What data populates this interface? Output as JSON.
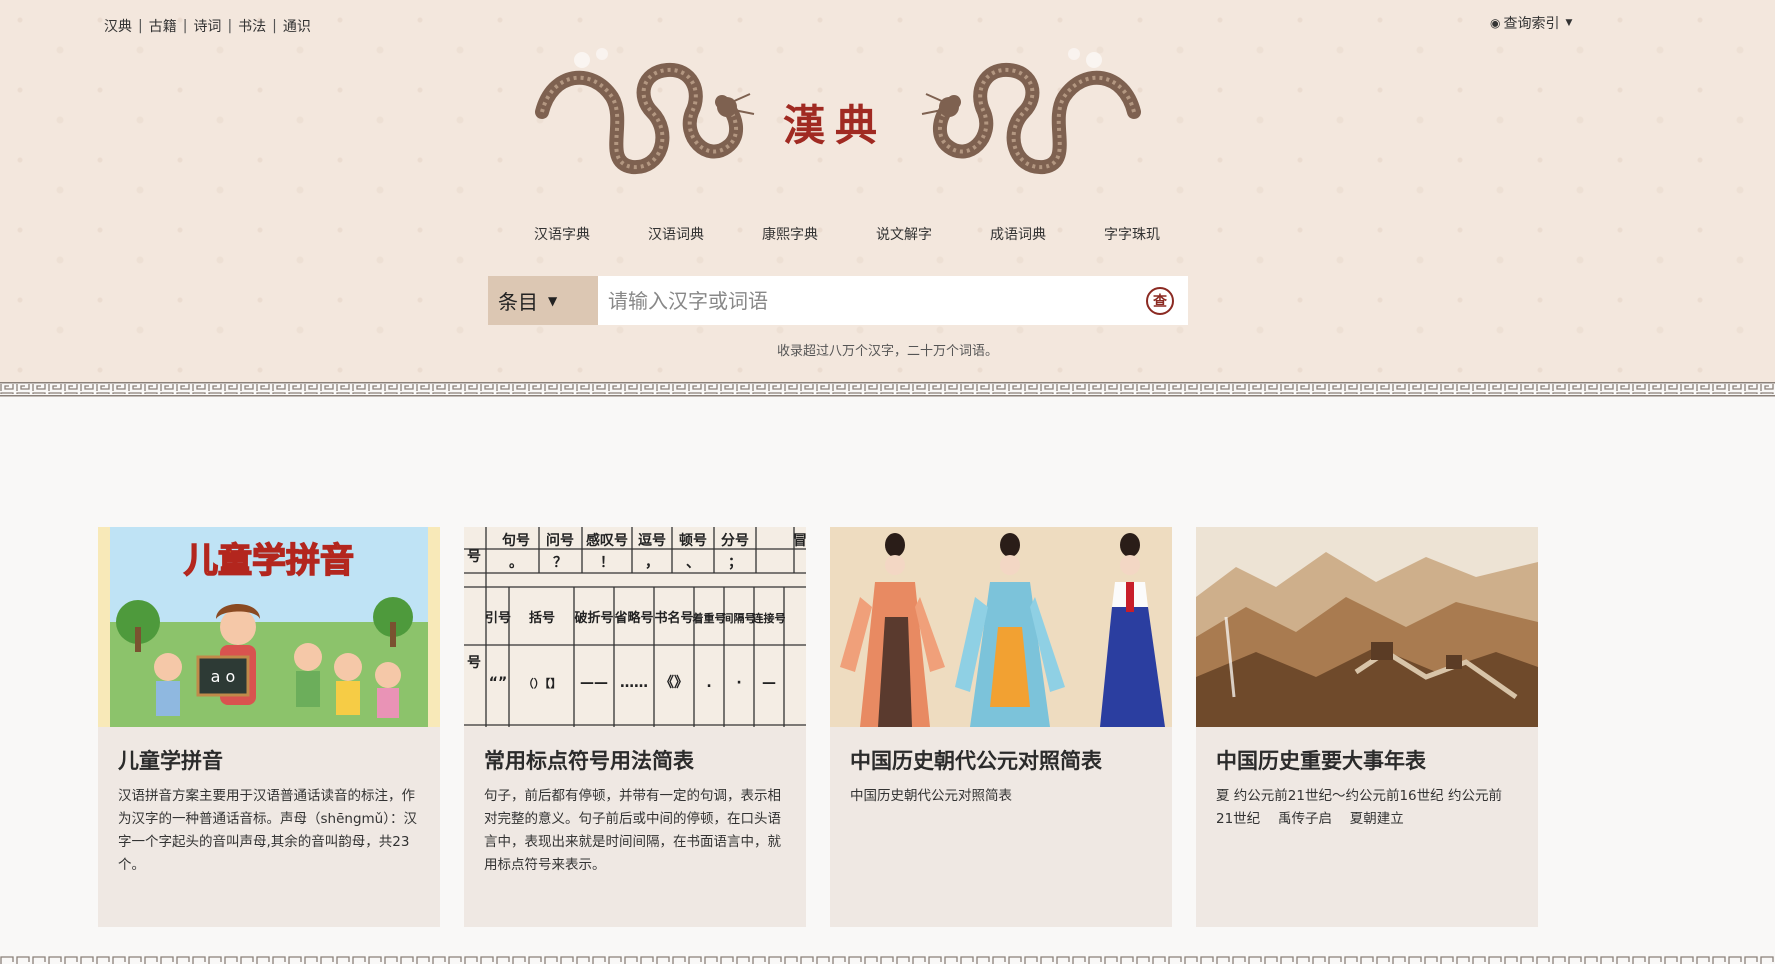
{
  "top_links": [
    "汉典",
    "古籍",
    "诗词",
    "书法",
    "通识"
  ],
  "query_index": {
    "label": "查询索引"
  },
  "logo": {
    "text": "漢典"
  },
  "nav": [
    "汉语字典",
    "汉语词典",
    "康熙字典",
    "说文解字",
    "成语词典",
    "字字珠玑"
  ],
  "search": {
    "select_label": "条目",
    "placeholder": "请输入汉字或词语",
    "button_glyph": "查"
  },
  "subtitle": "收录超过八万个汉字，二十万个词语。",
  "cards": [
    {
      "title": "儿童学拼音",
      "image_text": "儿童学拼音",
      "board_text": "a o",
      "desc": "汉语拼音方案主要用于汉语普通话读音的标注，作为汉字的一种普通话音标。声母（shēngmǔ）：汉字一个字起头的音叫声母,其余的音叫韵母，共23个。"
    },
    {
      "title": "常用标点符号用法简表",
      "table_row1": [
        "号",
        "句号",
        "问号",
        "感叹号",
        "逗号",
        "顿号",
        "分号",
        "冒"
      ],
      "table_row1_marks": [
        "",
        "。",
        "？",
        "！",
        "，",
        "、",
        "；",
        ""
      ],
      "table_row2": [
        "",
        "引号",
        "括号",
        "破折号",
        "省略号",
        "书名号",
        "着重号",
        "间隔号",
        "连接号"
      ],
      "table_row2_marks": [
        "号",
        "“”",
        "（）【】",
        "——",
        "……",
        "《》",
        ".",
        "·",
        "—"
      ],
      "desc": "句子，前后都有停顿，并带有一定的句调，表示相对完整的意义。句子前后或中间的停顿，在口头语言中，表现出来就是时间间隔，在书面语言中，就用标点符号来表示。"
    },
    {
      "title": "中国历史朝代公元对照简表",
      "desc": "中国历史朝代公元对照简表"
    },
    {
      "title": "中国历史重要大事年表",
      "desc": "夏 约公元前21世纪～约公元前16世纪 约公元前21世纪　 禹传子启　 夏朝建立"
    }
  ],
  "colors": {
    "header_bg": "#f3e7dd",
    "logo_red": "#a02a22",
    "select_bg": "#dcc7b3",
    "card_bg": "#efe8e3"
  }
}
